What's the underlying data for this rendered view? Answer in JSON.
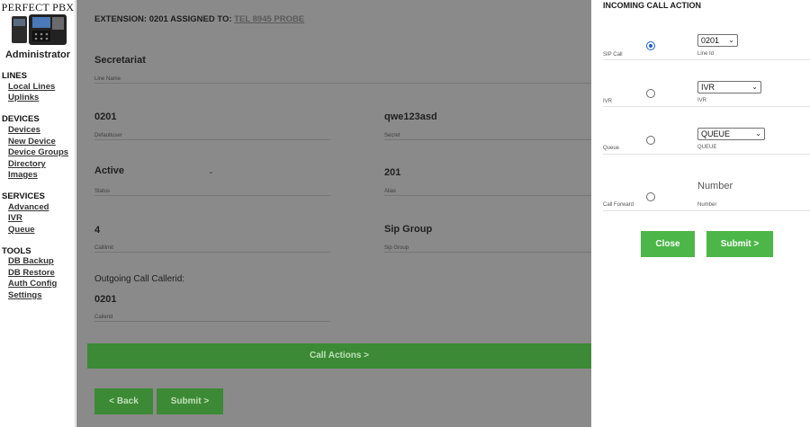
{
  "sidebar": {
    "brand": "PERFECT PBX",
    "role": "Administrator",
    "sections": [
      {
        "title": "LINES",
        "items": [
          "Local Lines",
          "Uplinks"
        ]
      },
      {
        "title": "DEVICES",
        "items": [
          "Devices",
          "New Device",
          "Device Groups",
          "Directory",
          "Images"
        ]
      },
      {
        "title": "SERVICES",
        "items": [
          "Advanced",
          "IVR",
          "Queue"
        ]
      },
      {
        "title": "TOOLS",
        "items": [
          "DB Backup",
          "DB Restore",
          "Auth Config",
          "Settings"
        ]
      }
    ]
  },
  "main": {
    "header_prefix": "EXTENSION: 0201 ASSIGNED TO:",
    "header_link": "TEL 8945 PROBE",
    "fields": {
      "line_name": {
        "value": "Secretariat",
        "label": "Line Name"
      },
      "defaultuser": {
        "value": "0201",
        "label": "Defaultuser"
      },
      "secret": {
        "value": "qwe123asd",
        "label": "Secret"
      },
      "status": {
        "value": "Active",
        "label": "Status"
      },
      "alias": {
        "value": "201",
        "label": "Alias"
      },
      "calllimit": {
        "value": "4",
        "label": "Calllimit"
      },
      "sip_group": {
        "value": "Sip Group",
        "label": "Sip Group"
      },
      "callerid": {
        "value": "0201",
        "label": "Callerid"
      }
    },
    "outgoing_title": "Outgoing Call Callerid:",
    "call_actions_label": "Call Actions >",
    "back_label": "< Back",
    "submit_label": "Submit >"
  },
  "panel": {
    "title": "INCOMING CALL ACTION",
    "options": [
      {
        "tag": "SIP Call",
        "selected": "0201",
        "sublabel": "Line Id",
        "checked": true
      },
      {
        "tag": "IVR",
        "selected": "IVR",
        "sublabel": "IVR",
        "checked": false
      },
      {
        "tag": "Queue",
        "selected": "QUEUE",
        "sublabel": "QUEUE",
        "checked": false
      },
      {
        "tag": "Call Forward",
        "placeholder": "Number",
        "sublabel": "Number",
        "checked": false
      }
    ],
    "close_label": "Close",
    "submit_label": "Submit >"
  },
  "colors": {
    "overlay_gray": "#8a8a8a",
    "button_green": "#4cb648",
    "dim_green": "#3c8a35",
    "radio_blue": "#1a5fd0"
  }
}
